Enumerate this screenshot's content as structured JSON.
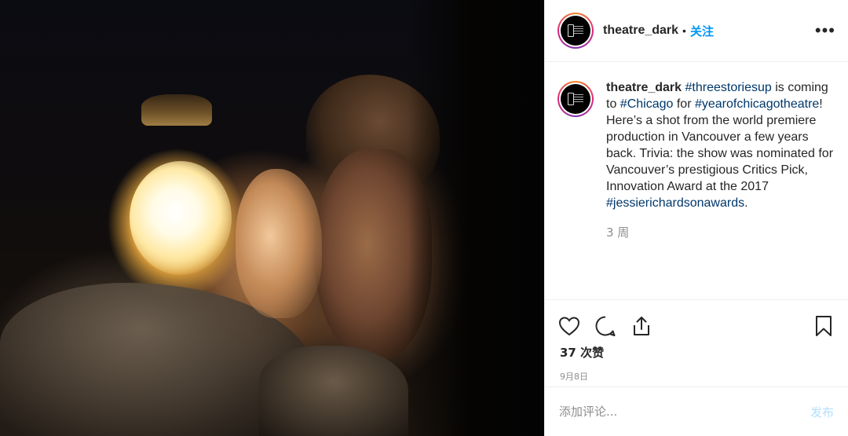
{
  "post": {
    "photo_alt": "",
    "username": "theatre_dark",
    "follow_label": "关注",
    "more_label": "•••",
    "caption": {
      "username": "theatre_dark",
      "tag1": "#threestoriesup",
      "text1": " is coming to ",
      "tag2": "#Chicago",
      "text2": " for ",
      "tag3": "#yearofchicagotheatre",
      "text3": "! Here’s a shot from the world premiere production in Vancouver a few years back. Trivia: the show was nominated for Vancouver’s prestigious Critics Pick, Innovation Award at the 2017 ",
      "tag4": "#jessierichardsonawards",
      "text4": "."
    },
    "time_ago": "3 周",
    "likes": "37 次赞",
    "date": "9月8日",
    "comment_placeholder": "添加评论...",
    "post_label": "发布"
  },
  "icons": {
    "like": "heart-icon",
    "comment": "comment-icon",
    "share": "share-icon",
    "save": "bookmark-icon"
  },
  "colors": {
    "link": "#0095f6",
    "hashtag": "#00376b",
    "muted": "#8e8e8e",
    "post_disabled": "#b2dffc"
  }
}
